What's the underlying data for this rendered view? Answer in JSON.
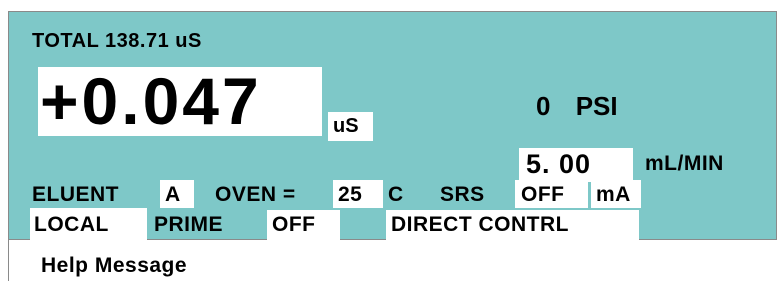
{
  "total": {
    "label": "TOTAL",
    "value": "138.71",
    "unit": "uS"
  },
  "reading": {
    "value": "+0.047",
    "unit": "uS"
  },
  "pressure": {
    "value": "0",
    "unit": "PSI"
  },
  "flow": {
    "value": "5. 00",
    "unit": "mL/MIN"
  },
  "eluent": {
    "label": "ELUENT",
    "value": "A"
  },
  "oven": {
    "label": "OVEN =",
    "value": "25",
    "unit": "C"
  },
  "srs": {
    "label": "SRS",
    "value": "OFF",
    "unit": "mA"
  },
  "mode": {
    "local": "LOCAL",
    "prime_label": "PRIME",
    "prime_value": "OFF",
    "control": "DIRECT CONTRL"
  },
  "help": {
    "label": "Help Message"
  },
  "colors": {
    "panel": "#7ec8c8",
    "field": "#ffffff",
    "text": "#000000"
  }
}
